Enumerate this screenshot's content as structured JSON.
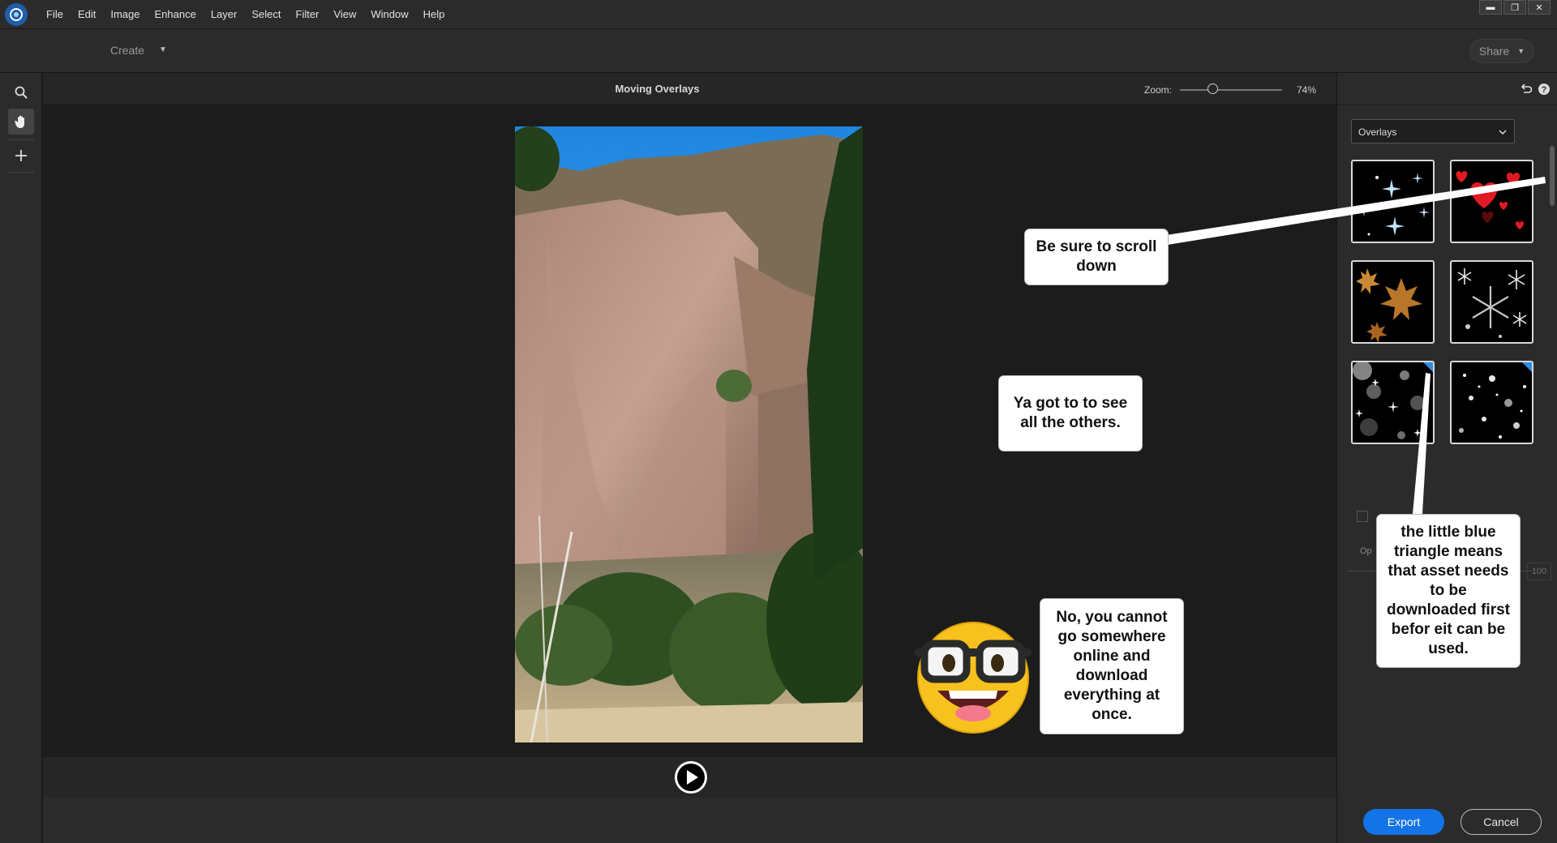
{
  "menu": [
    "File",
    "Edit",
    "Image",
    "Enhance",
    "Layer",
    "Select",
    "Filter",
    "View",
    "Window",
    "Help"
  ],
  "window_controls": {
    "minimize": "▬",
    "restore": "❐",
    "close": "✕"
  },
  "topbar": {
    "create_label": "Create",
    "share_label": "Share"
  },
  "tools": [
    {
      "name": "zoom-tool",
      "icon": "search-icon"
    },
    {
      "name": "hand-tool",
      "icon": "hand-icon"
    },
    {
      "name": "move-tool",
      "icon": "plus-icon"
    }
  ],
  "document": {
    "title": "Moving Overlays",
    "zoom_label": "Zoom:",
    "zoom_value": "74%",
    "zoom_level": 0.33
  },
  "panel": {
    "category": "Overlays",
    "overlays": [
      {
        "name": "sparkles-overlay",
        "needs_download": false
      },
      {
        "name": "hearts-overlay",
        "needs_download": false
      },
      {
        "name": "autumn-leaves-overlay",
        "needs_download": false
      },
      {
        "name": "snowflakes-overlay",
        "needs_download": false
      },
      {
        "name": "bokeh-sparkles-overlay",
        "needs_download": true
      },
      {
        "name": "snowfall-overlay",
        "needs_download": true
      }
    ],
    "opacity_label": "Op",
    "opacity_value": "100"
  },
  "footer": {
    "export_label": "Export",
    "cancel_label": "Cancel"
  },
  "callouts": {
    "scroll": "Be sure to scroll down",
    "others": "Ya got to to see all the others.",
    "triangle": "the little blue triangle means that asset needs to be downloaded first befor eit can be used.",
    "cannot": "No, you cannot go somewhere online and download everything at once."
  },
  "colors": {
    "accent": "#1473e6",
    "download_triangle": "#2f8be0"
  }
}
